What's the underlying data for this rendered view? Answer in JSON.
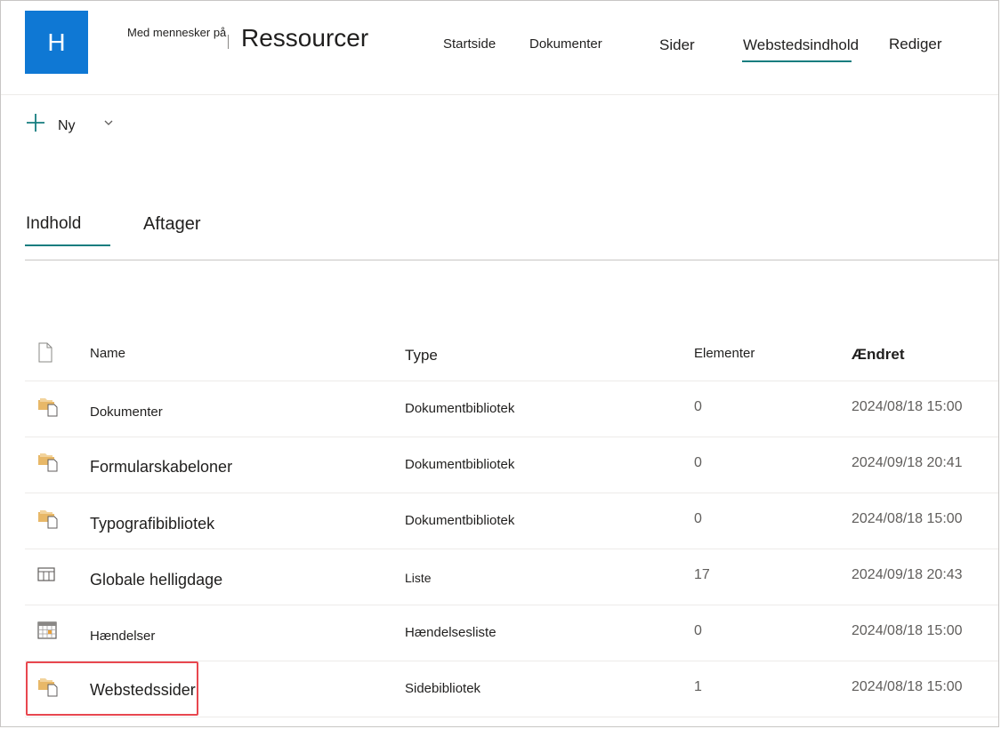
{
  "site": {
    "logo_letter": "H",
    "subtitle": "Med mennesker på",
    "title": "Ressourcer",
    "brand_color": "#0f78d4"
  },
  "topnav": {
    "items": [
      {
        "label": "Startside"
      },
      {
        "label": "Dokumenter"
      },
      {
        "label": "Sider"
      },
      {
        "label": "Webstedsindhold",
        "selected": true
      },
      {
        "label": "Rediger"
      }
    ],
    "accent_color": "#167d7f"
  },
  "command_bar": {
    "new_label": "Ny",
    "new_icon": "plus-icon",
    "dropdown_icon": "chevron-down-icon"
  },
  "pivots": {
    "items": [
      {
        "label": "Indhold",
        "selected": true
      },
      {
        "label": "Aftager"
      }
    ]
  },
  "table": {
    "columns": {
      "icon": "file-type-icon",
      "name": "Name",
      "type": "Type",
      "items": "Elementer",
      "modified": "Ændret"
    },
    "rows": [
      {
        "icon": "document-library-icon",
        "name": "Dokumenter",
        "type": "Dokumentbibliotek",
        "items": "0",
        "modified": "2024/08/18 15:00"
      },
      {
        "icon": "document-library-icon",
        "name": "Formularskabeloner",
        "type": "Dokumentbibliotek",
        "items": "0",
        "modified": "2024/09/18 20:41"
      },
      {
        "icon": "document-library-icon",
        "name": "Typografibibliotek",
        "type": "Dokumentbibliotek",
        "items": "0",
        "modified": "2024/08/18 15:00"
      },
      {
        "icon": "list-icon",
        "name": "Globale helligdage",
        "type": "Liste",
        "items": "17",
        "modified": "2024/09/18 20:43"
      },
      {
        "icon": "calendar-icon",
        "name": "Hændelser",
        "type": "Hændelsesliste",
        "items": "0",
        "modified": "2024/08/18 15:00"
      },
      {
        "icon": "document-library-icon",
        "name": "Webstedssider",
        "type": "Sidebibliotek",
        "items": "1",
        "modified": "2024/08/18 15:00",
        "highlighted": true
      }
    ],
    "highlight_color": "#e8474f"
  }
}
